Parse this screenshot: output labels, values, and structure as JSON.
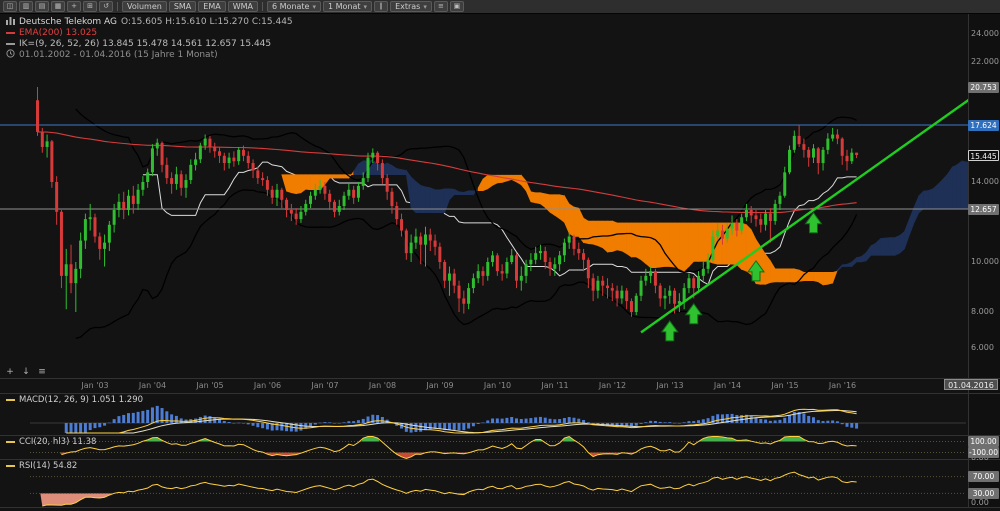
{
  "toolbar": {
    "caret": "▾",
    "left_icons": [
      {
        "name": "layout-icon",
        "glyph": "◫"
      },
      {
        "name": "candlestick-chart-icon",
        "glyph": "▥"
      },
      {
        "name": "bar-chart-icon",
        "glyph": "▤"
      },
      {
        "name": "line-chart-icon",
        "glyph": "▦"
      },
      {
        "name": "add-indicator-icon",
        "glyph": "+"
      },
      {
        "name": "grid-icon",
        "glyph": "⊞"
      },
      {
        "name": "undo-icon",
        "glyph": "↺"
      }
    ],
    "buttons": [
      {
        "label": "Volumen"
      },
      {
        "label": "SMA"
      },
      {
        "label": "EMA"
      },
      {
        "label": "WMA"
      }
    ],
    "dropdowns": [
      {
        "label": "6 Monate"
      },
      {
        "label": "1 Monat"
      },
      {
        "label": "Extras"
      }
    ],
    "right_icons": [
      {
        "name": "pause-icon",
        "glyph": "∥"
      },
      {
        "name": "list-icon",
        "glyph": "≡"
      },
      {
        "name": "settings-icon",
        "glyph": "▣"
      }
    ]
  },
  "legend": {
    "instrument": "Deutsche Telekom AG",
    "ohlc": "O:15.605 H:15.610 L:15.270 C:15.445",
    "ema": "EMA(200) 13.025",
    "ichimoku": "IK=(9, 26, 52, 26) 13.845 15.478 14.561 12.657 15.445",
    "range": "01.01.2002 - 01.04.2016 (15 Jahre 1 Monat)"
  },
  "axis": {
    "price_ticks": [
      {
        "label": "24.000",
        "price": 24.0,
        "style": "plain"
      },
      {
        "label": "22.000",
        "price": 22.0,
        "style": "plain"
      },
      {
        "label": "20.753",
        "price": 20.753,
        "style": "gray"
      },
      {
        "label": "17.624",
        "price": 17.624,
        "style": "blue"
      },
      {
        "label": "15.445",
        "price": 15.445,
        "style": "last"
      },
      {
        "label": "14.000",
        "price": 14.0,
        "style": "plain"
      },
      {
        "label": "12.657",
        "price": 12.657,
        "style": "gray"
      },
      {
        "label": "10.000",
        "price": 10.0,
        "style": "plain"
      },
      {
        "label": "8.000",
        "price": 8.0,
        "style": "plain"
      },
      {
        "label": "6.000",
        "price": 6.0,
        "style": "plain"
      }
    ],
    "x_labels": [
      "Jan '03",
      "Jan '04",
      "Jan '05",
      "Jan '06",
      "Jan '07",
      "Jan '08",
      "Jan '09",
      "Jan '10",
      "Jan '11",
      "Jan '12",
      "Jan '13",
      "Jan '14",
      "Jan '15",
      "Jan '16"
    ],
    "date_badge": "01.04.2016"
  },
  "mini_toolbar": [
    {
      "name": "crosshair-icon",
      "glyph": "+"
    },
    {
      "name": "jump-latest-icon",
      "glyph": "↓"
    },
    {
      "name": "chart-menu-icon",
      "glyph": "≡"
    }
  ],
  "panels": {
    "macd": {
      "legend": "MACD(12, 26, 9) 1.051 1.290"
    },
    "cci": {
      "legend": "CCI(20, hl3) 11.38",
      "badges": [
        "100.00",
        "-100.00"
      ],
      "bottom": "0.00"
    },
    "rsi": {
      "legend": "RSI(14) 54.82",
      "badges": [
        "70.00",
        "30.00"
      ],
      "bottom": "0.00"
    }
  },
  "colors": {
    "up": "#2fbe2f",
    "down": "#d83a3a",
    "cloud_bear": "#f07c00",
    "cloud_bull": "#1f3057",
    "ema": "#d43c3c",
    "kijun": "#dcdcdc",
    "trend": "#21cc21",
    "macd_hist": "#4c7cd4",
    "macd_line": "#ffd042",
    "macd_signal": "#e6e0c0",
    "osc_line": "#ffd042",
    "cci_high": "#45b14c",
    "cci_low": "#c94b32",
    "rsi_low_fill": "#e8937e",
    "level_blue": "#3c78c8",
    "level_gray": "#909090"
  },
  "chart_data": {
    "type": "candlestick",
    "instrument": "Deutsche Telekom AG",
    "interval": "1 Monat",
    "range": "01.01.2002 - 01.04.2016",
    "indicators": {
      "overlays": [
        "EMA(200)",
        "IK (9, 26, 52, 26)"
      ],
      "panels": [
        "MACD(12, 26, 9)",
        "CCI(20, hl3)",
        "RSI(14)"
      ]
    },
    "levels": [
      {
        "price": 17.624,
        "style": "blue"
      },
      {
        "price": 12.657,
        "style": "gray"
      },
      {
        "price": 20.753,
        "style": "badge-only"
      }
    ],
    "trendline": {
      "from": {
        "index": 126,
        "price": 6.8
      },
      "to": {
        "index": 196,
        "price": 20.1
      }
    },
    "arrows": [
      {
        "index": 132,
        "price": 7.45
      },
      {
        "index": 137,
        "price": 8.3
      },
      {
        "index": 150,
        "price": 10.05
      },
      {
        "index": 162,
        "price": 12.45
      }
    ],
    "ohlc": [
      [
        19.6,
        20.753,
        16.8,
        17.1
      ],
      [
        17.1,
        17.4,
        15.6,
        16.0
      ],
      [
        16.0,
        16.9,
        15.3,
        16.4
      ],
      [
        16.4,
        16.5,
        13.7,
        14.0
      ],
      [
        14.0,
        14.3,
        11.8,
        12.5
      ],
      [
        12.5,
        12.6,
        8.9,
        9.4
      ],
      [
        9.4,
        10.6,
        8.1,
        9.9
      ],
      [
        9.9,
        10.8,
        8.7,
        9.1
      ],
      [
        9.1,
        10.0,
        8.0,
        9.7
      ],
      [
        9.7,
        11.4,
        9.3,
        11.0
      ],
      [
        11.0,
        12.4,
        10.6,
        12.1
      ],
      [
        12.1,
        12.9,
        11.5,
        12.2
      ],
      [
        12.2,
        12.4,
        10.9,
        11.2
      ],
      [
        11.2,
        11.4,
        10.1,
        10.6
      ],
      [
        10.6,
        11.3,
        9.8,
        10.9
      ],
      [
        10.9,
        12.0,
        10.5,
        11.8
      ],
      [
        11.8,
        12.9,
        11.4,
        12.6
      ],
      [
        12.6,
        13.4,
        12.2,
        13.0
      ],
      [
        13.0,
        13.5,
        12.1,
        12.6
      ],
      [
        12.6,
        13.6,
        12.3,
        13.3
      ],
      [
        13.3,
        13.8,
        12.4,
        12.9
      ],
      [
        12.9,
        13.9,
        12.6,
        13.6
      ],
      [
        13.6,
        14.3,
        13.3,
        14.0
      ],
      [
        14.0,
        14.7,
        13.7,
        14.5
      ],
      [
        14.5,
        16.2,
        14.3,
        15.9
      ],
      [
        15.9,
        16.6,
        15.4,
        16.3
      ],
      [
        16.3,
        16.4,
        14.5,
        14.9
      ],
      [
        14.9,
        15.3,
        13.9,
        14.2
      ],
      [
        14.2,
        14.5,
        13.4,
        13.9
      ],
      [
        13.9,
        14.8,
        13.6,
        14.4
      ],
      [
        14.4,
        14.6,
        13.3,
        13.7
      ],
      [
        13.7,
        14.4,
        13.2,
        14.1
      ],
      [
        14.1,
        15.2,
        13.9,
        14.9
      ],
      [
        14.9,
        15.6,
        14.6,
        15.2
      ],
      [
        15.2,
        16.3,
        15.0,
        16.1
      ],
      [
        16.1,
        16.9,
        15.8,
        16.6
      ],
      [
        16.6,
        16.8,
        15.6,
        16.0
      ],
      [
        16.0,
        16.3,
        15.3,
        15.7
      ],
      [
        15.7,
        16.0,
        15.0,
        15.4
      ],
      [
        15.4,
        15.6,
        14.6,
        15.0
      ],
      [
        15.0,
        15.6,
        14.7,
        15.3
      ],
      [
        15.3,
        15.7,
        14.8,
        15.1
      ],
      [
        15.1,
        16.0,
        14.9,
        15.8
      ],
      [
        15.8,
        16.1,
        15.1,
        15.4
      ],
      [
        15.4,
        15.7,
        14.7,
        15.0
      ],
      [
        15.0,
        15.2,
        14.2,
        14.6
      ],
      [
        14.6,
        14.8,
        13.9,
        14.2
      ],
      [
        14.2,
        14.5,
        13.8,
        14.1
      ],
      [
        14.1,
        14.3,
        13.3,
        13.6
      ],
      [
        13.6,
        13.8,
        12.9,
        13.2
      ],
      [
        13.2,
        13.9,
        12.8,
        13.6
      ],
      [
        13.6,
        13.7,
        12.7,
        13.1
      ],
      [
        13.1,
        13.2,
        12.2,
        12.6
      ],
      [
        12.6,
        12.9,
        12.0,
        12.4
      ],
      [
        12.4,
        12.7,
        11.8,
        12.1
      ],
      [
        12.1,
        12.8,
        11.9,
        12.5
      ],
      [
        12.5,
        13.1,
        12.3,
        12.9
      ],
      [
        12.9,
        13.5,
        12.7,
        13.3
      ],
      [
        13.3,
        13.9,
        13.1,
        13.6
      ],
      [
        13.6,
        14.1,
        13.4,
        13.8
      ],
      [
        13.8,
        14.0,
        13.1,
        13.4
      ],
      [
        13.4,
        13.6,
        12.6,
        13.0
      ],
      [
        13.0,
        13.1,
        12.2,
        12.5
      ],
      [
        12.5,
        13.1,
        12.3,
        12.8
      ],
      [
        12.8,
        13.5,
        12.6,
        13.3
      ],
      [
        13.3,
        13.9,
        13.1,
        13.6
      ],
      [
        13.6,
        13.8,
        12.9,
        13.2
      ],
      [
        13.2,
        14.0,
        13.0,
        13.8
      ],
      [
        13.8,
        14.5,
        13.6,
        14.2
      ],
      [
        14.2,
        15.6,
        14.0,
        15.3
      ],
      [
        15.3,
        15.9,
        15.0,
        15.6
      ],
      [
        15.6,
        15.7,
        14.6,
        15.0
      ],
      [
        15.0,
        15.2,
        13.9,
        14.2
      ],
      [
        14.2,
        14.4,
        13.1,
        13.5
      ],
      [
        13.5,
        13.7,
        12.4,
        12.8
      ],
      [
        12.8,
        13.0,
        11.8,
        12.1
      ],
      [
        12.1,
        12.4,
        11.2,
        11.5
      ],
      [
        11.5,
        11.6,
        10.1,
        10.4
      ],
      [
        10.4,
        11.3,
        10.0,
        10.9
      ],
      [
        10.9,
        11.6,
        10.6,
        11.2
      ],
      [
        11.2,
        11.4,
        9.9,
        10.8
      ],
      [
        10.8,
        11.7,
        9.8,
        11.3
      ],
      [
        11.3,
        11.6,
        10.5,
        11.0
      ],
      [
        11.0,
        11.3,
        10.3,
        10.7
      ],
      [
        10.7,
        10.9,
        9.7,
        10.0
      ],
      [
        10.0,
        10.1,
        8.9,
        9.2
      ],
      [
        9.2,
        9.8,
        8.6,
        9.5
      ],
      [
        9.5,
        9.7,
        8.7,
        9.0
      ],
      [
        9.0,
        9.2,
        8.0,
        8.5
      ],
      [
        8.5,
        8.8,
        7.9,
        8.3
      ],
      [
        8.3,
        9.1,
        8.1,
        8.9
      ],
      [
        8.9,
        9.5,
        8.7,
        9.3
      ],
      [
        9.3,
        9.9,
        9.1,
        9.6
      ],
      [
        9.6,
        9.8,
        9.0,
        9.4
      ],
      [
        9.4,
        10.2,
        9.2,
        10.0
      ],
      [
        10.0,
        10.5,
        9.8,
        10.3
      ],
      [
        10.3,
        10.4,
        9.4,
        9.6
      ],
      [
        9.6,
        9.9,
        9.2,
        9.5
      ],
      [
        9.5,
        10.2,
        9.3,
        10.0
      ],
      [
        10.0,
        10.6,
        9.9,
        10.3
      ],
      [
        10.3,
        10.4,
        8.9,
        9.2
      ],
      [
        9.2,
        9.8,
        8.8,
        9.4
      ],
      [
        9.4,
        10.1,
        9.1,
        9.9
      ],
      [
        9.9,
        10.4,
        9.6,
        10.1
      ],
      [
        10.1,
        10.7,
        9.9,
        10.4
      ],
      [
        10.4,
        10.8,
        10.1,
        10.5
      ],
      [
        10.5,
        10.7,
        9.7,
        10.0
      ],
      [
        10.0,
        10.2,
        9.4,
        9.7
      ],
      [
        9.7,
        10.2,
        9.4,
        9.9
      ],
      [
        9.9,
        10.5,
        9.6,
        10.3
      ],
      [
        10.3,
        11.1,
        10.0,
        10.9
      ],
      [
        10.9,
        11.4,
        10.6,
        11.2
      ],
      [
        11.2,
        11.3,
        10.3,
        10.6
      ],
      [
        10.6,
        10.9,
        10.1,
        10.4
      ],
      [
        10.4,
        10.6,
        9.6,
        10.1
      ],
      [
        10.1,
        10.2,
        8.9,
        9.3
      ],
      [
        9.3,
        9.5,
        8.4,
        8.8
      ],
      [
        8.8,
        9.4,
        8.5,
        9.2
      ],
      [
        9.2,
        9.4,
        8.6,
        9.0
      ],
      [
        9.0,
        9.3,
        8.5,
        8.9
      ],
      [
        8.9,
        9.1,
        8.4,
        8.8
      ],
      [
        8.8,
        9.0,
        8.2,
        8.5
      ],
      [
        8.5,
        9.0,
        8.3,
        8.8
      ],
      [
        8.8,
        8.9,
        8.1,
        8.4
      ],
      [
        8.4,
        8.5,
        7.7,
        8.0
      ],
      [
        8.0,
        8.7,
        7.8,
        8.6
      ],
      [
        8.6,
        9.4,
        8.4,
        9.2
      ],
      [
        9.2,
        9.7,
        9.0,
        9.4
      ],
      [
        9.4,
        9.8,
        9.1,
        9.6
      ],
      [
        9.6,
        9.7,
        8.7,
        9.0
      ],
      [
        9.0,
        9.1,
        8.2,
        8.5
      ],
      [
        8.5,
        8.9,
        8.1,
        8.6
      ],
      [
        8.6,
        9.0,
        8.3,
        8.8
      ],
      [
        8.8,
        8.9,
        7.9,
        8.3
      ],
      [
        8.3,
        8.7,
        8.0,
        8.4
      ],
      [
        8.4,
        9.1,
        8.1,
        8.9
      ],
      [
        8.9,
        9.5,
        8.7,
        9.3
      ],
      [
        9.3,
        9.4,
        8.5,
        8.9
      ],
      [
        8.9,
        9.6,
        8.7,
        9.4
      ],
      [
        9.4,
        10.0,
        9.2,
        9.7
      ],
      [
        9.7,
        10.4,
        9.5,
        10.1
      ],
      [
        10.1,
        11.5,
        10.0,
        11.2
      ],
      [
        11.2,
        11.9,
        11.0,
        11.5
      ],
      [
        11.5,
        11.8,
        10.8,
        11.1
      ],
      [
        11.1,
        11.9,
        10.9,
        11.6
      ],
      [
        11.6,
        12.3,
        11.3,
        11.9
      ],
      [
        11.9,
        12.1,
        11.2,
        11.5
      ],
      [
        11.5,
        12.4,
        11.3,
        12.2
      ],
      [
        12.2,
        12.9,
        12.0,
        12.6
      ],
      [
        12.6,
        12.8,
        11.9,
        12.3
      ],
      [
        12.3,
        12.6,
        11.7,
        12.1
      ],
      [
        12.1,
        12.4,
        11.4,
        11.8
      ],
      [
        11.8,
        12.6,
        11.5,
        12.4
      ],
      [
        12.4,
        12.7,
        10.9,
        12.0
      ],
      [
        12.0,
        13.1,
        11.8,
        12.9
      ],
      [
        12.9,
        13.5,
        12.6,
        13.3
      ],
      [
        13.3,
        14.8,
        13.2,
        14.5
      ],
      [
        14.5,
        16.1,
        14.4,
        15.8
      ],
      [
        15.8,
        17.2,
        15.6,
        16.8
      ],
      [
        16.8,
        17.624,
        16.0,
        16.2
      ],
      [
        16.2,
        16.6,
        15.3,
        15.8
      ],
      [
        15.8,
        16.0,
        14.8,
        15.3
      ],
      [
        15.3,
        16.2,
        15.0,
        15.9
      ],
      [
        15.9,
        16.0,
        14.4,
        15.0
      ],
      [
        15.0,
        16.0,
        14.6,
        15.8
      ],
      [
        15.8,
        17.0,
        15.5,
        16.6
      ],
      [
        16.6,
        17.4,
        16.4,
        16.9
      ],
      [
        16.9,
        17.3,
        16.2,
        16.6
      ],
      [
        16.6,
        16.7,
        14.9,
        15.4
      ],
      [
        15.4,
        15.8,
        14.6,
        15.1
      ],
      [
        15.1,
        15.9,
        14.95,
        15.605
      ],
      [
        15.605,
        15.61,
        15.27,
        15.445
      ]
    ]
  }
}
